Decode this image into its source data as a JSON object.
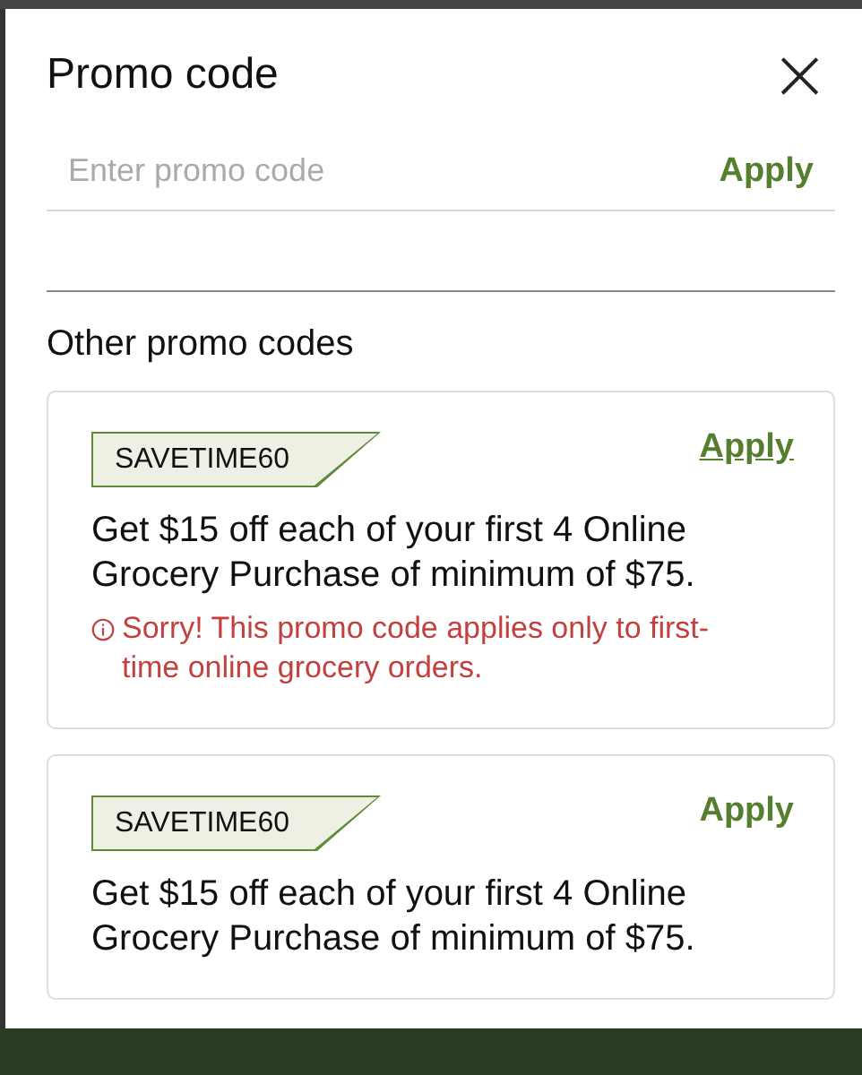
{
  "dialog": {
    "title": "Promo code",
    "close": "×"
  },
  "promo_field": {
    "placeholder": "Enter promo code",
    "apply": "Apply"
  },
  "section_title": "Other promo codes",
  "promos": [
    {
      "code": "SAVETIME60",
      "apply": "Apply",
      "apply_underlined": true,
      "description": "Get $15 off each of your first 4 Online Grocery Purchase of minimum of $75.",
      "error": "Sorry! This promo code applies only to first-time online grocery orders."
    },
    {
      "code": "SAVETIME60",
      "apply": "Apply",
      "apply_underlined": false,
      "description": "Get $15 off each of your first 4 Online Grocery Purchase of minimum of $75."
    }
  ]
}
